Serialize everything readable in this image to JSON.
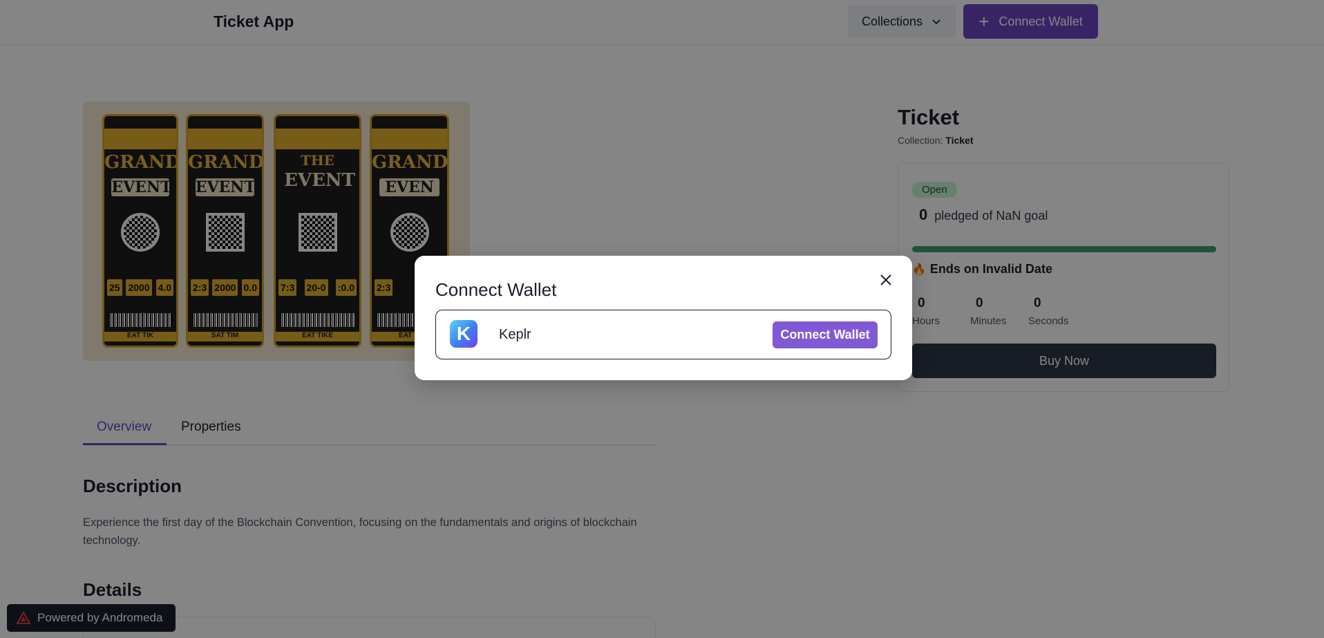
{
  "header": {
    "app_title": "Ticket App",
    "collections_label": "Collections",
    "connect_label": "Connect Wallet"
  },
  "hero": {
    "tickets": [
      {
        "top_word": "GRAND",
        "event": "EVENT",
        "n1": "25",
        "n2": "2000",
        "n3": "4.0",
        "footer": "EAT TIK"
      },
      {
        "top_word": "GRAND",
        "event": "EVENT",
        "n1": "2:3",
        "n2": "2000",
        "n3": "0.0",
        "footer": "SAT TIM"
      },
      {
        "top_word": "THE",
        "event": "EVENT",
        "n1": "7:3",
        "n2": "20-0",
        "n3": ":0.0",
        "footer": "EAT TIKE"
      },
      {
        "top_word": "GRAND",
        "event": "EVEN",
        "n1": "2:3",
        "n2": "20",
        "n3": "",
        "footer": "EAT TI"
      }
    ]
  },
  "tabs": [
    {
      "label": "Overview",
      "active": true
    },
    {
      "label": "Properties",
      "active": false
    }
  ],
  "description": {
    "heading": "Description",
    "text": "Experience the first day of the Blockchain Convention, focusing on the fundamentals and origins of blockchain technology."
  },
  "details": {
    "heading": "Details"
  },
  "product": {
    "title": "Ticket",
    "collection_prefix": "Collection:",
    "collection_name": "Ticket",
    "status": "Open",
    "pledged_amount": "0",
    "pledged_text": "pledged of NaN goal",
    "progress": 1.0,
    "ends_text": "Ends on Invalid Date",
    "countdown": [
      {
        "value": "0",
        "label": "Hours"
      },
      {
        "value": "0",
        "label": "Minutes"
      },
      {
        "value": "0",
        "label": "Seconds"
      }
    ],
    "buy_label": "Buy Now"
  },
  "powered_by": "Powered by Andromeda",
  "modal": {
    "title": "Connect Wallet",
    "wallet_name": "Keplr",
    "wallet_icon_letter": "K",
    "wallet_button": "Connect Wallet"
  },
  "colors": {
    "accent": "#6b46c1",
    "progress": "#38a169",
    "buy": "#2d3748"
  }
}
